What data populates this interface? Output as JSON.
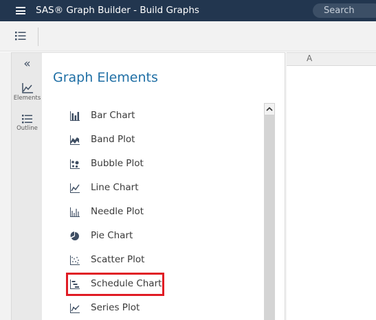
{
  "app": {
    "title": "SAS® Graph Builder - Build Graphs",
    "search_placeholder": "Search",
    "bar_color": "#22364f"
  },
  "toolbar": {
    "icons": [
      "list-icon"
    ]
  },
  "left_nav": {
    "collapse_glyph": "«",
    "items": [
      {
        "label": "Elements",
        "icon": "line-chart-icon"
      },
      {
        "label": "Outline",
        "icon": "outline-list-icon"
      }
    ]
  },
  "panel": {
    "title": "Graph Elements",
    "title_color": "#1f6fa5",
    "items": [
      {
        "label": "Bar Chart",
        "icon": "bar-chart-icon"
      },
      {
        "label": "Band Plot",
        "icon": "band-plot-icon"
      },
      {
        "label": "Bubble Plot",
        "icon": "bubble-plot-icon"
      },
      {
        "label": "Line Chart",
        "icon": "line-chart-icon"
      },
      {
        "label": "Needle Plot",
        "icon": "needle-plot-icon"
      },
      {
        "label": "Pie Chart",
        "icon": "pie-chart-icon"
      },
      {
        "label": "Scatter Plot",
        "icon": "scatter-plot-icon"
      },
      {
        "label": "Schedule Chart",
        "icon": "schedule-chart-icon"
      },
      {
        "label": "Series Plot",
        "icon": "series-plot-icon"
      }
    ],
    "highlighted_item": "Schedule Chart",
    "highlight_color": "#e01b24"
  },
  "canvas": {
    "column_label": "A"
  }
}
